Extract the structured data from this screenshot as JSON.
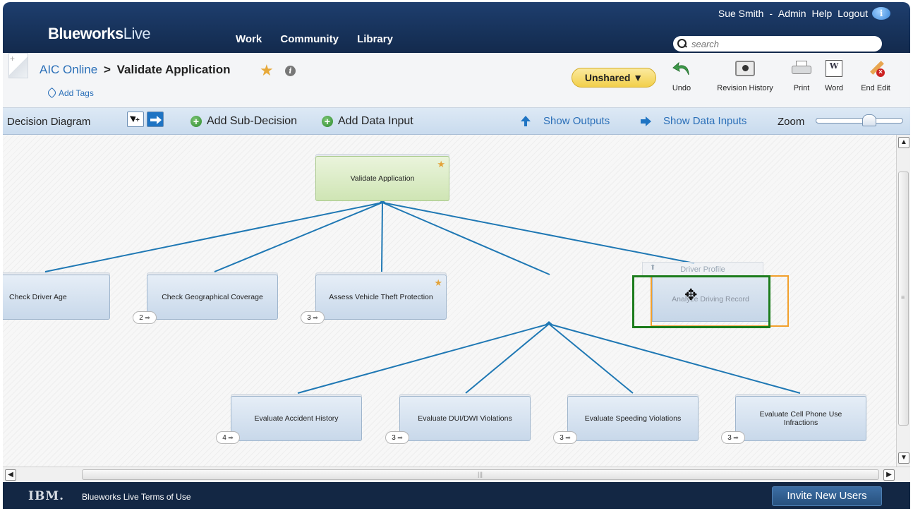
{
  "header": {
    "user": "Sue Smith",
    "user_separator": "-",
    "links": [
      "Admin",
      "Help",
      "Logout"
    ],
    "logo_bold": "Blueworks",
    "logo_light": "Live",
    "nav": [
      "Work",
      "Community",
      "Library"
    ],
    "search_placeholder": "search",
    "info_icon": "i"
  },
  "title_bar": {
    "breadcrumb_parent": "AIC Online",
    "breadcrumb_separator": ">",
    "breadcrumb_current": "Validate Application",
    "add_tags": "Add Tags",
    "share_status": "Unshared ▼",
    "tools": {
      "undo": "Undo",
      "revision_history": "Revision History",
      "print": "Print",
      "word": "Word",
      "word_icon": "W",
      "end_edit": "End Edit"
    }
  },
  "toolbar": {
    "label": "Decision Diagram",
    "add_sub_decision": "Add Sub-Decision",
    "add_data_input": "Add Data Input",
    "show_outputs": "Show Outputs",
    "show_data_inputs": "Show Data Inputs",
    "zoom_label": "Zoom"
  },
  "diagram": {
    "link_color": "#1f78b4",
    "root": {
      "label": "Validate Application",
      "starred": true
    },
    "nodes": {
      "check_driver_age": {
        "label": "Check Driver Age"
      },
      "check_geo": {
        "label": "Check Geographical Coverage",
        "count": "2"
      },
      "assess_theft": {
        "label": "Assess Vehicle Theft Protection",
        "count": "3",
        "starred": true
      },
      "analyze_driving_record": {
        "label": "Analyze Driving Record"
      },
      "eval_accident": {
        "label": "Evaluate Accident History",
        "count": "4"
      },
      "eval_dui": {
        "label": "Evaluate DUI/DWI Violations",
        "count": "3"
      },
      "eval_speeding": {
        "label": "Evaluate Speeding Violations",
        "count": "3"
      },
      "eval_cell": {
        "label": "Evaluate Cell Phone Use Infractions",
        "count": "3"
      }
    },
    "ghost_label": "Driver Profile"
  },
  "footer": {
    "ibm": "IBM.",
    "terms": "Blueworks Live Terms of Use",
    "invite": "Invite New Users"
  }
}
